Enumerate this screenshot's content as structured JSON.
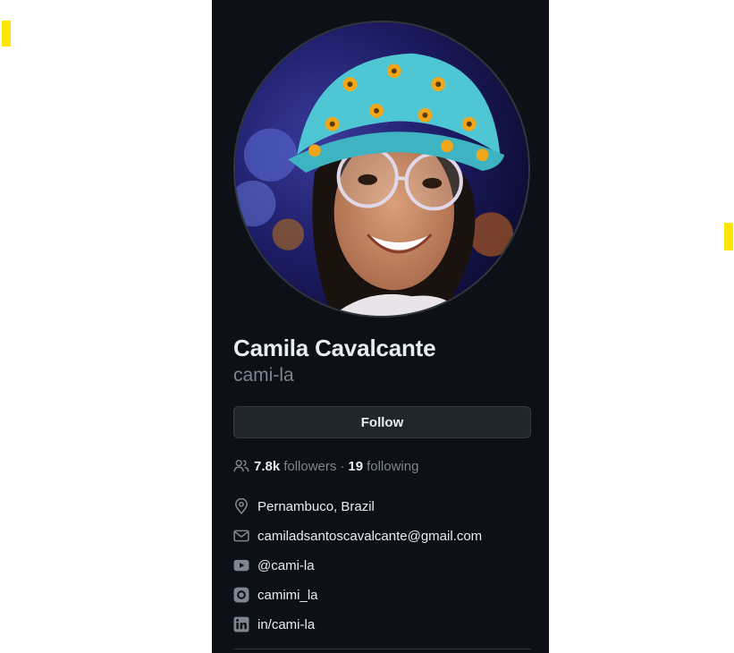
{
  "profile": {
    "name": "Camila Cavalcante",
    "login": "cami-la",
    "follow_label": "Follow",
    "followers_count": "7.8k",
    "followers_label": "followers",
    "separator": "·",
    "following_count": "19",
    "following_label": "following"
  },
  "details": {
    "location": "Pernambuco, Brazil",
    "email": "camiladsantoscavalcante@gmail.com",
    "youtube": "@cami-la",
    "instagram": "camimi_la",
    "linkedin": "in/cami-la"
  },
  "icons": {
    "followers": "people-icon",
    "location": "location-pin-icon",
    "email": "mail-icon",
    "youtube": "youtube-icon",
    "instagram": "instagram-icon",
    "linkedin": "linkedin-icon"
  },
  "colors": {
    "panel_bg": "#0d1117",
    "text_primary": "#e6edf3",
    "text_muted": "#7d8590",
    "button_bg": "#21262d",
    "marker": "#ffe600"
  }
}
